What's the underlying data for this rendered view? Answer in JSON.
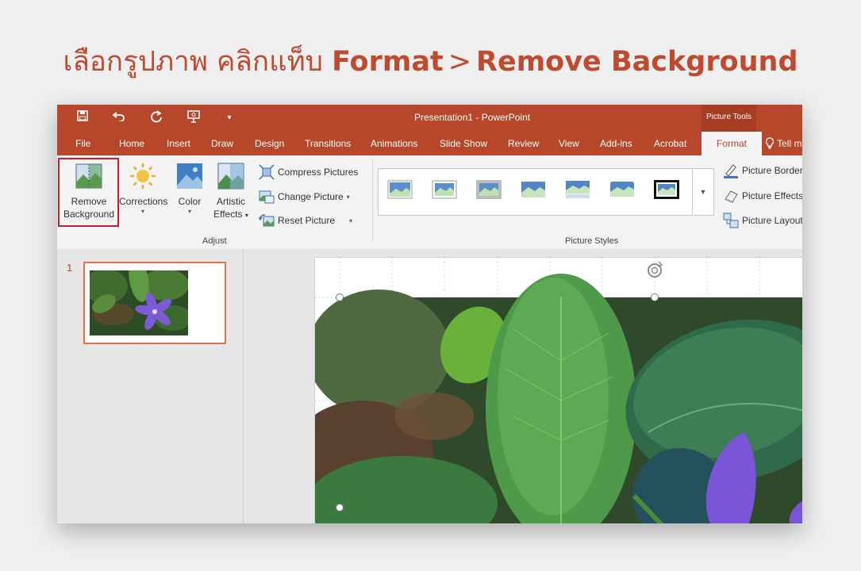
{
  "headline": {
    "prefix": "เลือกรูปภาพ คลิกแท็บ",
    "format": "Format",
    "sep": ">",
    "target": "Remove Background"
  },
  "window": {
    "title": "Presentation1  -  PowerPoint",
    "context_tab_group": "Picture Tools"
  },
  "quick_access": {
    "save_icon": "save-icon",
    "undo_icon": "undo-icon",
    "redo_icon": "redo-icon",
    "present_icon": "present-from-start-icon",
    "customize_icon": "customize-quick-access-icon"
  },
  "tabs": [
    "File",
    "Home",
    "Insert",
    "Draw",
    "Design",
    "Transitions",
    "Animations",
    "Slide Show",
    "Review",
    "View",
    "Add-ins",
    "Acrobat"
  ],
  "active_tab": "Format",
  "tell_me": "Tell m",
  "ribbon": {
    "remove_bg": {
      "line1": "Remove",
      "line2": "Background"
    },
    "corrections": "Corrections",
    "color": "Color",
    "artistic": {
      "line1": "Artistic",
      "line2": "Effects"
    },
    "compress": "Compress Pictures",
    "change": "Change Picture",
    "reset": "Reset Picture",
    "adjust_group": "Adjust",
    "styles_group": "Picture Styles",
    "border": "Picture Border",
    "effects": "Picture Effects",
    "layout": "Picture Layout"
  },
  "slides": {
    "number": "1"
  },
  "colors": {
    "accent": "#b7472a",
    "headline": "#c0492e",
    "highlight": "#d2182a"
  }
}
